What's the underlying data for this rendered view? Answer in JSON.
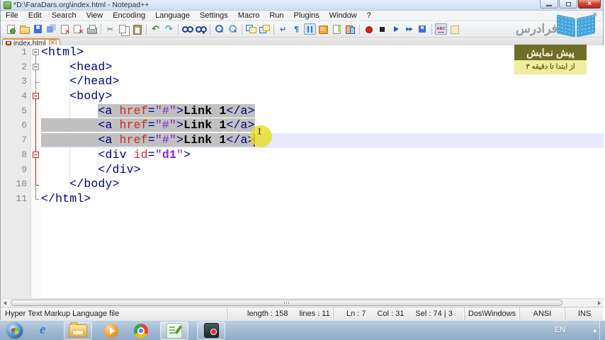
{
  "titlebar": {
    "title": "*D:\\FaraDars.org\\index.html - Notepad++"
  },
  "menubar": {
    "items": [
      "File",
      "Edit",
      "Search",
      "View",
      "Encoding",
      "Language",
      "Settings",
      "Macro",
      "Run",
      "Plugins",
      "Window",
      "?"
    ],
    "overlay_close": "×"
  },
  "toolbar": {
    "icons": [
      {
        "name": "new-file-icon",
        "cls": "pgbase i-new"
      },
      {
        "name": "open-file-icon",
        "cls": "i-open"
      },
      {
        "name": "save-icon",
        "cls": "i-save"
      },
      {
        "name": "save-all-icon",
        "cls": "i-saveall"
      },
      {
        "name": "close-file-icon",
        "cls": "pgbase i-close"
      },
      {
        "name": "close-all-icon",
        "cls": "i-closeall"
      },
      {
        "name": "print-icon",
        "cls": "i-print"
      },
      {
        "sep": true
      },
      {
        "name": "cut-icon",
        "cls": "i-cut",
        "glyph": "✂"
      },
      {
        "name": "copy-icon",
        "cls": "i-copy"
      },
      {
        "name": "paste-icon",
        "cls": "i-paste"
      },
      {
        "sep": true
      },
      {
        "name": "undo-icon",
        "cls": "i-undo",
        "glyph": "↶"
      },
      {
        "name": "redo-icon",
        "cls": "i-redo",
        "glyph": "↷"
      },
      {
        "sep": true
      },
      {
        "name": "find-icon",
        "cls": "i-find"
      },
      {
        "name": "replace-icon",
        "cls": "i-replace"
      },
      {
        "sep": true
      },
      {
        "name": "zoom-in-icon",
        "cls": "i-zoomin"
      },
      {
        "name": "zoom-out-icon",
        "cls": "i-zoomout"
      },
      {
        "sep": true
      },
      {
        "name": "sync-vertical-icon",
        "cls": "i-syncv"
      },
      {
        "name": "sync-horizontal-icon",
        "cls": "i-synch"
      },
      {
        "sep": true
      },
      {
        "name": "word-wrap-icon",
        "cls": "i-wrap",
        "glyph": "↵"
      },
      {
        "name": "show-all-characters-icon",
        "cls": "i-para",
        "glyph": "¶"
      },
      {
        "name": "indent-guide-icon",
        "cls": "i-guide",
        "pressed": true
      },
      {
        "name": "function-list-icon",
        "cls": "i-funclist"
      },
      {
        "name": "doc-map-icon",
        "cls": "i-docmap"
      },
      {
        "name": "doc-switcher-icon",
        "cls": "i-docswitch"
      },
      {
        "sep": true
      },
      {
        "name": "macro-record-icon",
        "cls": "i-record"
      },
      {
        "name": "macro-stop-icon",
        "cls": "i-stop"
      },
      {
        "name": "macro-play-icon",
        "cls": "i-play"
      },
      {
        "name": "macro-run-multiple-icon",
        "cls": "i-multiplay",
        "glyph": "▶▶"
      },
      {
        "name": "macro-save-icon",
        "cls": "i-savemacro"
      },
      {
        "sep": true
      },
      {
        "name": "spell-check-icon",
        "cls": "i-spell",
        "pressed": true,
        "glyph": "ABC"
      },
      {
        "name": "document-panel-icon",
        "cls": "i-lightdoc"
      }
    ]
  },
  "tabbar": {
    "label": "index.html",
    "modified": true
  },
  "editor": {
    "lines": [
      {
        "n": "1",
        "fold": "box1",
        "current": false,
        "tokens": [
          [
            "t",
            "<html>",
            0
          ]
        ]
      },
      {
        "n": "2",
        "fold": "box2",
        "current": false,
        "tokens": [
          [
            "w",
            "    ",
            0
          ],
          [
            "t",
            "<head>",
            0
          ]
        ]
      },
      {
        "n": "3",
        "fold": "branch",
        "current": false,
        "tokens": [
          [
            "w",
            "    ",
            0
          ],
          [
            "t",
            "</head>",
            0
          ]
        ]
      },
      {
        "n": "4",
        "fold": "boxr1",
        "current": false,
        "tokens": [
          [
            "w",
            "    ",
            0
          ],
          [
            "t",
            "<body>",
            0
          ]
        ]
      },
      {
        "n": "5",
        "fold": "vr",
        "current": false,
        "tokens": [
          [
            "w",
            "        ",
            0
          ],
          [
            "t",
            "<a ",
            1
          ],
          [
            "a",
            "href",
            1
          ],
          [
            "t",
            "=",
            1
          ],
          [
            "s",
            "\"#\"",
            1
          ],
          [
            "t",
            ">",
            1
          ],
          [
            "b",
            "Link 1",
            1
          ],
          [
            "t",
            "</a>",
            1
          ]
        ]
      },
      {
        "n": "6",
        "fold": "vr",
        "current": false,
        "tokens": [
          [
            "w",
            "        ",
            1
          ],
          [
            "t",
            "<a ",
            1
          ],
          [
            "a",
            "href",
            1
          ],
          [
            "t",
            "=",
            1
          ],
          [
            "s",
            "\"#\"",
            1
          ],
          [
            "t",
            ">",
            1
          ],
          [
            "b",
            "Link 1",
            1
          ],
          [
            "t",
            "</a>",
            1
          ]
        ]
      },
      {
        "n": "7",
        "fold": "vr",
        "current": true,
        "tokens": [
          [
            "w",
            "        ",
            1
          ],
          [
            "t",
            "<a ",
            1
          ],
          [
            "a",
            "href",
            1
          ],
          [
            "t",
            "=",
            1
          ],
          [
            "s",
            "\"#\"",
            1
          ],
          [
            "t",
            ">",
            1
          ],
          [
            "b",
            "Link 1",
            1
          ],
          [
            "t",
            "</a>",
            1
          ]
        ]
      },
      {
        "n": "8",
        "fold": "boxr2",
        "current": false,
        "tokens": [
          [
            "w",
            "        ",
            0
          ],
          [
            "t",
            "<div ",
            0
          ],
          [
            "a",
            "id",
            0
          ],
          [
            "t",
            "=",
            0
          ],
          [
            "s",
            "\"",
            0
          ],
          [
            "sb",
            "d1",
            0
          ],
          [
            "s",
            "\"",
            0
          ],
          [
            "t",
            ">",
            0
          ]
        ]
      },
      {
        "n": "9",
        "fold": "vr",
        "current": false,
        "tokens": [
          [
            "w",
            "        ",
            0
          ],
          [
            "t",
            "</div>",
            0
          ]
        ]
      },
      {
        "n": "10",
        "fold": "endr",
        "current": false,
        "tokens": [
          [
            "w",
            "    ",
            0
          ],
          [
            "t",
            "</body>",
            0
          ]
        ]
      },
      {
        "n": "11",
        "fold": "endg",
        "current": false,
        "tokens": [
          [
            "t",
            "</html>",
            0
          ]
        ]
      }
    ]
  },
  "statusbar": {
    "doctype": "Hyper Text Markup Language file",
    "length": "length : 158",
    "lines": "lines : 11",
    "ln": "Ln : 7",
    "col": "Col : 31",
    "sel": "Sel : 74 | 3",
    "eol": "Dos\\Windows",
    "encoding": "ANSI",
    "mode": "INS"
  },
  "overlay": {
    "brand": "فرادرس",
    "badge_title": "پیش نمایش",
    "badge_subtitle": "از ابتدا تا دقیقه ۳"
  },
  "taskbar": {
    "language": "EN",
    "items": [
      {
        "name": "start-button",
        "cls": "tk-start"
      },
      {
        "name": "internet-explorer-icon",
        "cls": "tk-ie"
      },
      {
        "name": "windows-explorer-icon",
        "cls": "tk-folder",
        "open": true
      },
      {
        "name": "media-player-icon",
        "cls": "tk-wmp"
      },
      {
        "name": "chrome-icon",
        "cls": "tk-chrome"
      },
      {
        "name": "notepad-plus-plus-taskbar-icon",
        "cls": "tk-npp",
        "open": true,
        "active": true
      },
      {
        "name": "screen-recorder-icon",
        "cls": "tk-rec",
        "open": true
      }
    ]
  }
}
